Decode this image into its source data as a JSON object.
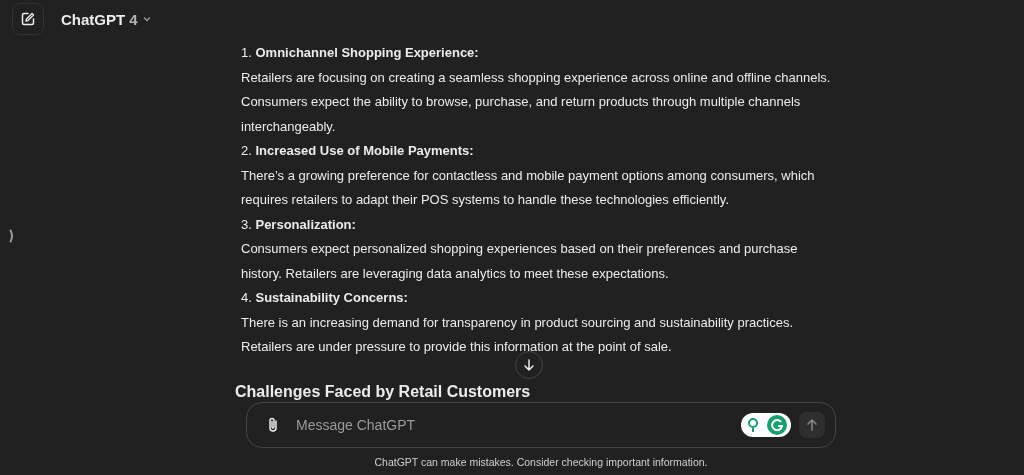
{
  "header": {
    "model_name": "ChatGPT",
    "model_version": "4"
  },
  "sections": [
    {
      "number": "1.",
      "title": "Omnichannel Shopping Experience:",
      "body": "Retailers are focusing on creating a seamless shopping experience across online and offline channels. Consumers expect the ability to browse, purchase, and return products through multiple channels interchangeably."
    },
    {
      "number": "2.",
      "title": "Increased Use of Mobile Payments:",
      "body": "There’s a growing preference for contactless and mobile payment options among consumers, which requires retailers to adapt their POS systems to handle these technologies efficiently."
    },
    {
      "number": "3.",
      "title": "Personalization:",
      "body": "Consumers expect personalized shopping experiences based on their preferences and purchase history. Retailers are leveraging data analytics to meet these expectations."
    },
    {
      "number": "4.",
      "title": "Sustainability Concerns:",
      "body": "There is an increasing demand for transparency in product sourcing and sustainability practices. Retailers are under pressure to provide this information at the point of sale."
    }
  ],
  "next_heading": "Challenges Faced by Retail Customers",
  "composer": {
    "placeholder": "Message ChatGPT"
  },
  "disclaimer": "ChatGPT can make mistakes. Consider checking important information."
}
